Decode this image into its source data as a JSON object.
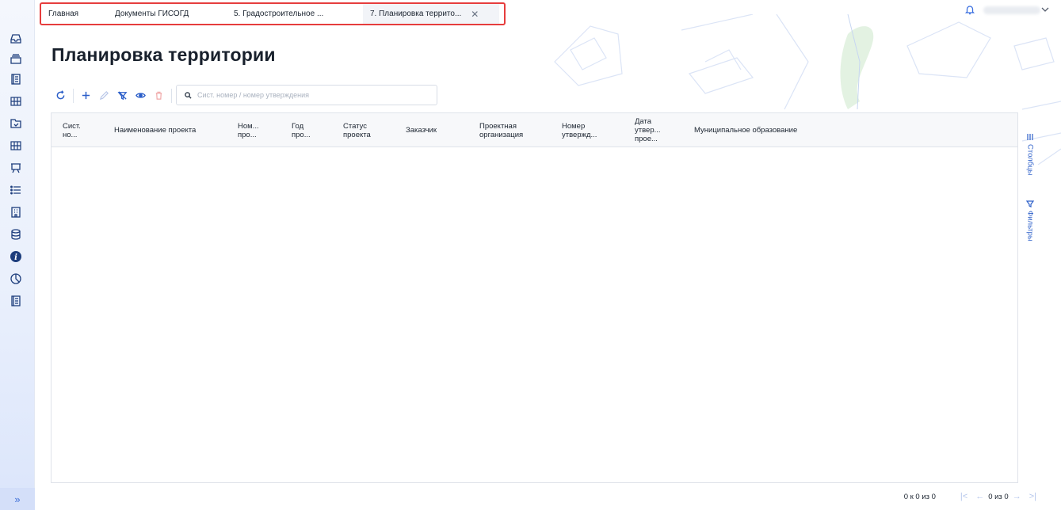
{
  "sidebar": {
    "items": [
      {
        "icon": "inbox-icon"
      },
      {
        "icon": "archive-icon"
      },
      {
        "icon": "register-book-icon"
      },
      {
        "icon": "map-grid-icon"
      },
      {
        "icon": "checked-folder-icon"
      },
      {
        "icon": "map-layers-icon"
      },
      {
        "icon": "presentation-board-icon"
      },
      {
        "icon": "list-icon"
      },
      {
        "icon": "building-icon"
      },
      {
        "icon": "database-icon"
      },
      {
        "icon": "info-icon"
      },
      {
        "icon": "pie-chart-icon"
      },
      {
        "icon": "document-book-icon"
      }
    ],
    "expand_label": "»"
  },
  "tabs": [
    {
      "label": "Главная"
    },
    {
      "label": "Документы ГИСОГД"
    },
    {
      "label": "5. Градостроительное ..."
    },
    {
      "label": "7. Планировка террито...",
      "active": true
    }
  ],
  "header": {
    "bell_icon": "bell-icon",
    "user_menu_icon": "chevron-down-icon"
  },
  "page": {
    "title": "Планировка территории"
  },
  "toolbar": {
    "buttons": [
      "refresh-icon",
      "add-icon",
      "edit-icon",
      "clear-filter-icon",
      "view-icon",
      "delete-icon"
    ]
  },
  "search": {
    "placeholder": "Сист. номер / номер утверждения",
    "value": ""
  },
  "table": {
    "columns": [
      [
        "Сист.",
        "но..."
      ],
      [
        "Наименование проекта"
      ],
      [
        "Ном...",
        "про..."
      ],
      [
        "Год",
        "про..."
      ],
      [
        "Статус",
        "проекта"
      ],
      [
        "Заказчик"
      ],
      [
        "Проектная",
        "организация"
      ],
      [
        "Номер",
        "утвержд..."
      ],
      [
        "Дата",
        "утвер...",
        "прое..."
      ],
      [
        "Муниципальное образование"
      ]
    ],
    "rows": []
  },
  "side_panel": {
    "columns_label": "Столбцы",
    "filters_label": "Фильтры"
  },
  "pagination": {
    "range": "0 к 0 из 0",
    "page": "0 из 0"
  },
  "colors": {
    "accent": "#2c5fc9",
    "highlight_border": "#e63d3d",
    "sidebar_bg": "#eaf0fc"
  }
}
